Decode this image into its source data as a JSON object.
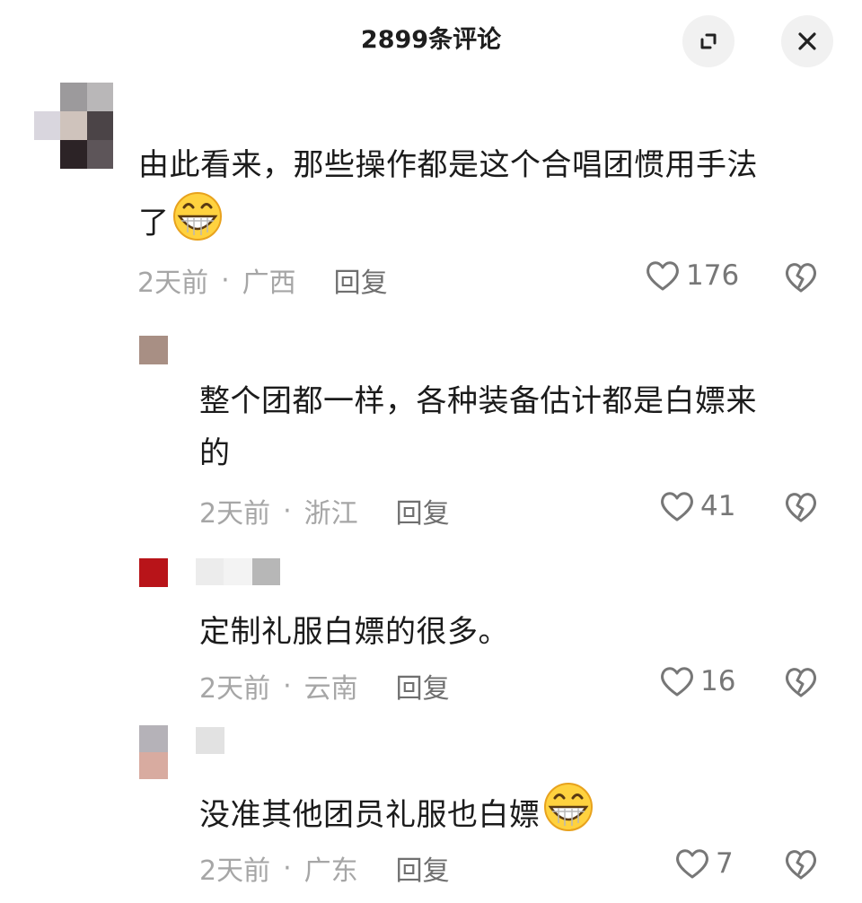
{
  "header": {
    "title": "2899条评论",
    "expand_icon": "collapse-icon",
    "close_icon": "close-icon"
  },
  "comments": [
    {
      "text": "由此看来，那些操作都是这个合唱团惯用手法了",
      "text_line1": "由此看来，那些操作都是这个合唱团惯用手法",
      "text_line2": "了",
      "emoji": "grin-emoji",
      "time": "2天前",
      "location": "广西",
      "reply": "回复",
      "likes": "176"
    },
    {
      "text": "整个团都一样，各种装备估计都是白嫖来的",
      "text_line1": "整个团都一样，各种装备估计都是白嫖来",
      "text_line2": "的",
      "time": "2天前",
      "location": "浙江",
      "reply": "回复",
      "likes": "41"
    },
    {
      "text": "定制礼服白嫖的很多。",
      "time": "2天前",
      "location": "云南",
      "reply": "回复",
      "likes": "16"
    },
    {
      "text": "没准其他团员礼服也白嫖",
      "emoji": "grin-emoji",
      "time": "2天前",
      "location": "广东",
      "reply": "回复",
      "likes": "7"
    }
  ],
  "separator": "·"
}
